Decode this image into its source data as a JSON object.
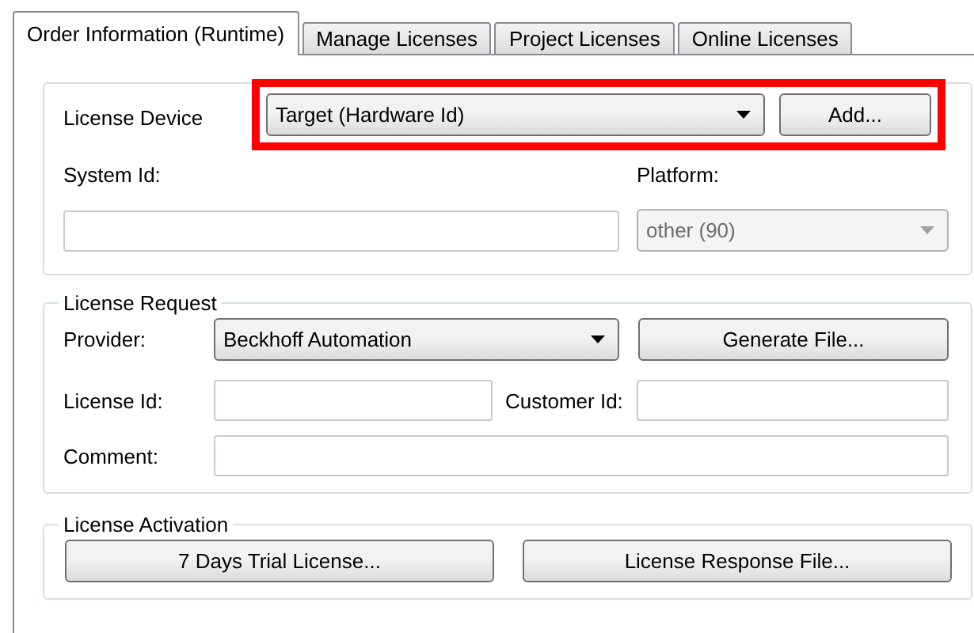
{
  "tabs": [
    {
      "label": "Order Information (Runtime)",
      "selected": true
    },
    {
      "label": "Manage Licenses",
      "selected": false
    },
    {
      "label": "Project Licenses",
      "selected": false
    },
    {
      "label": "Online Licenses",
      "selected": false
    }
  ],
  "license_device": {
    "label": "License Device",
    "value": "Target (Hardware Id)",
    "highlighted": true,
    "add_button": "Add..."
  },
  "system_id": {
    "label": "System Id:"
  },
  "platform": {
    "label": "Platform:",
    "value": "other (90)",
    "disabled": true
  },
  "license_request": {
    "title": "License Request",
    "provider_label": "Provider:",
    "provider_value": "Beckhoff Automation",
    "generate_button": "Generate File...",
    "license_id_label": "License Id:",
    "customer_id_label": "Customer Id:",
    "comment_label": "Comment:"
  },
  "license_activation": {
    "title": "License Activation",
    "buttons": [
      "7 Days Trial License...",
      "License Response File..."
    ]
  }
}
